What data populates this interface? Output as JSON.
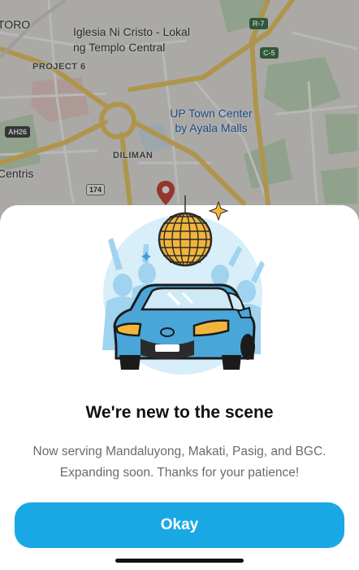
{
  "map": {
    "labels": {
      "toro": "TORO",
      "iglesia": "Iglesia Ni Cristo - Lokal ng Templo Central",
      "project6": "PROJECT 6",
      "up_town_center": "UP Town Center by Ayala Malls",
      "diliman": "DILIMAN",
      "centris": "Centris"
    },
    "shields": {
      "r7": "R-7",
      "c5": "C-5",
      "ah26": "AH26",
      "r174": "174"
    }
  },
  "modal": {
    "title": "We're new to the scene",
    "body": "Now serving Mandaluyong, Makati, Pasig, and BGC. Expanding soon. Thanks for your patience!",
    "button_label": "Okay"
  },
  "colors": {
    "accent": "#1aa8e4",
    "car": "#4aa6d8",
    "disco_ball": "#f2b53c"
  },
  "icons": {
    "map_pin": "location-pin-icon",
    "sparkle": "sparkle-icon"
  }
}
